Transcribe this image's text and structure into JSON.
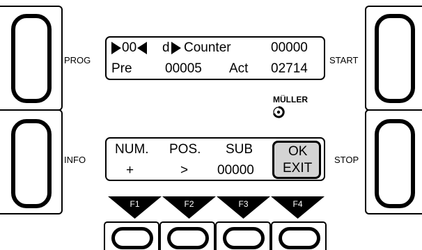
{
  "side_labels": {
    "prog": "PROG",
    "info": "INFO",
    "start": "START",
    "stop": "STOP"
  },
  "display1": {
    "row1": {
      "marker_value": "00",
      "dir_char": "d",
      "title": "Counter",
      "value": "00000"
    },
    "row2": {
      "pre_label": "Pre",
      "pre_value": "00005",
      "act_label": "Act",
      "act_value": "02714"
    }
  },
  "logo": {
    "text": "MÜLLER"
  },
  "display2": {
    "headers": {
      "num": "NUM.",
      "pos": "POS.",
      "sub": "SUB"
    },
    "values": {
      "num": "+",
      "pos": ">",
      "sub": "00000"
    },
    "ok_button": {
      "line1": "OK",
      "line2": "EXIT"
    }
  },
  "function_keys": [
    "F1",
    "F2",
    "F3",
    "F4"
  ],
  "colors": {
    "background": "#ffffff",
    "ink": "#000000",
    "ok_fill": "#d4d4d4"
  }
}
